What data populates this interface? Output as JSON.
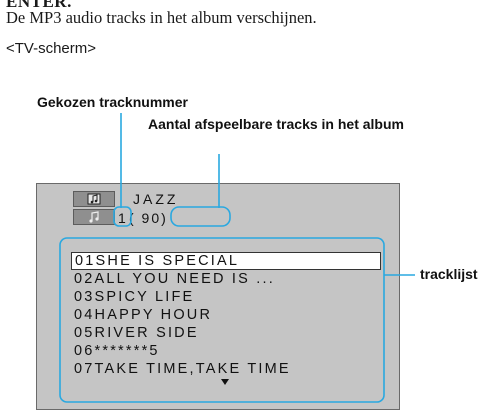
{
  "heading": "ENTER.",
  "instruction": "De MP3 audio tracks in het album verschijnen.",
  "screen_label": "<TV-scherm>",
  "callouts": {
    "chosen_track": "Gekozen tracknummer",
    "playable_count": "Aantal afspeelbare tracks in het album",
    "tracklist": "tracklijst"
  },
  "tv": {
    "album_name": "JAZZ",
    "track_number": "1",
    "track_total": "( 90)",
    "icons": [
      "folder-icon",
      "music-note-icon",
      "down-arrow-icon"
    ],
    "tracks": [
      {
        "label": "01SHE IS SPECIAL",
        "selected": true
      },
      {
        "label": "02ALL YOU NEED IS ...",
        "selected": false
      },
      {
        "label": "03SPICY LIFE",
        "selected": false
      },
      {
        "label": "04HAPPY HOUR",
        "selected": false
      },
      {
        "label": "05RIVER SIDE",
        "selected": false
      },
      {
        "label": "06*******5",
        "selected": false
      },
      {
        "label": "07TAKE TIME,TAKE TIME",
        "selected": false
      }
    ]
  },
  "colors": {
    "callout_line": "#2aa8e0",
    "screen_bg": "#c5c5c5",
    "highlight": "#ffffff"
  }
}
